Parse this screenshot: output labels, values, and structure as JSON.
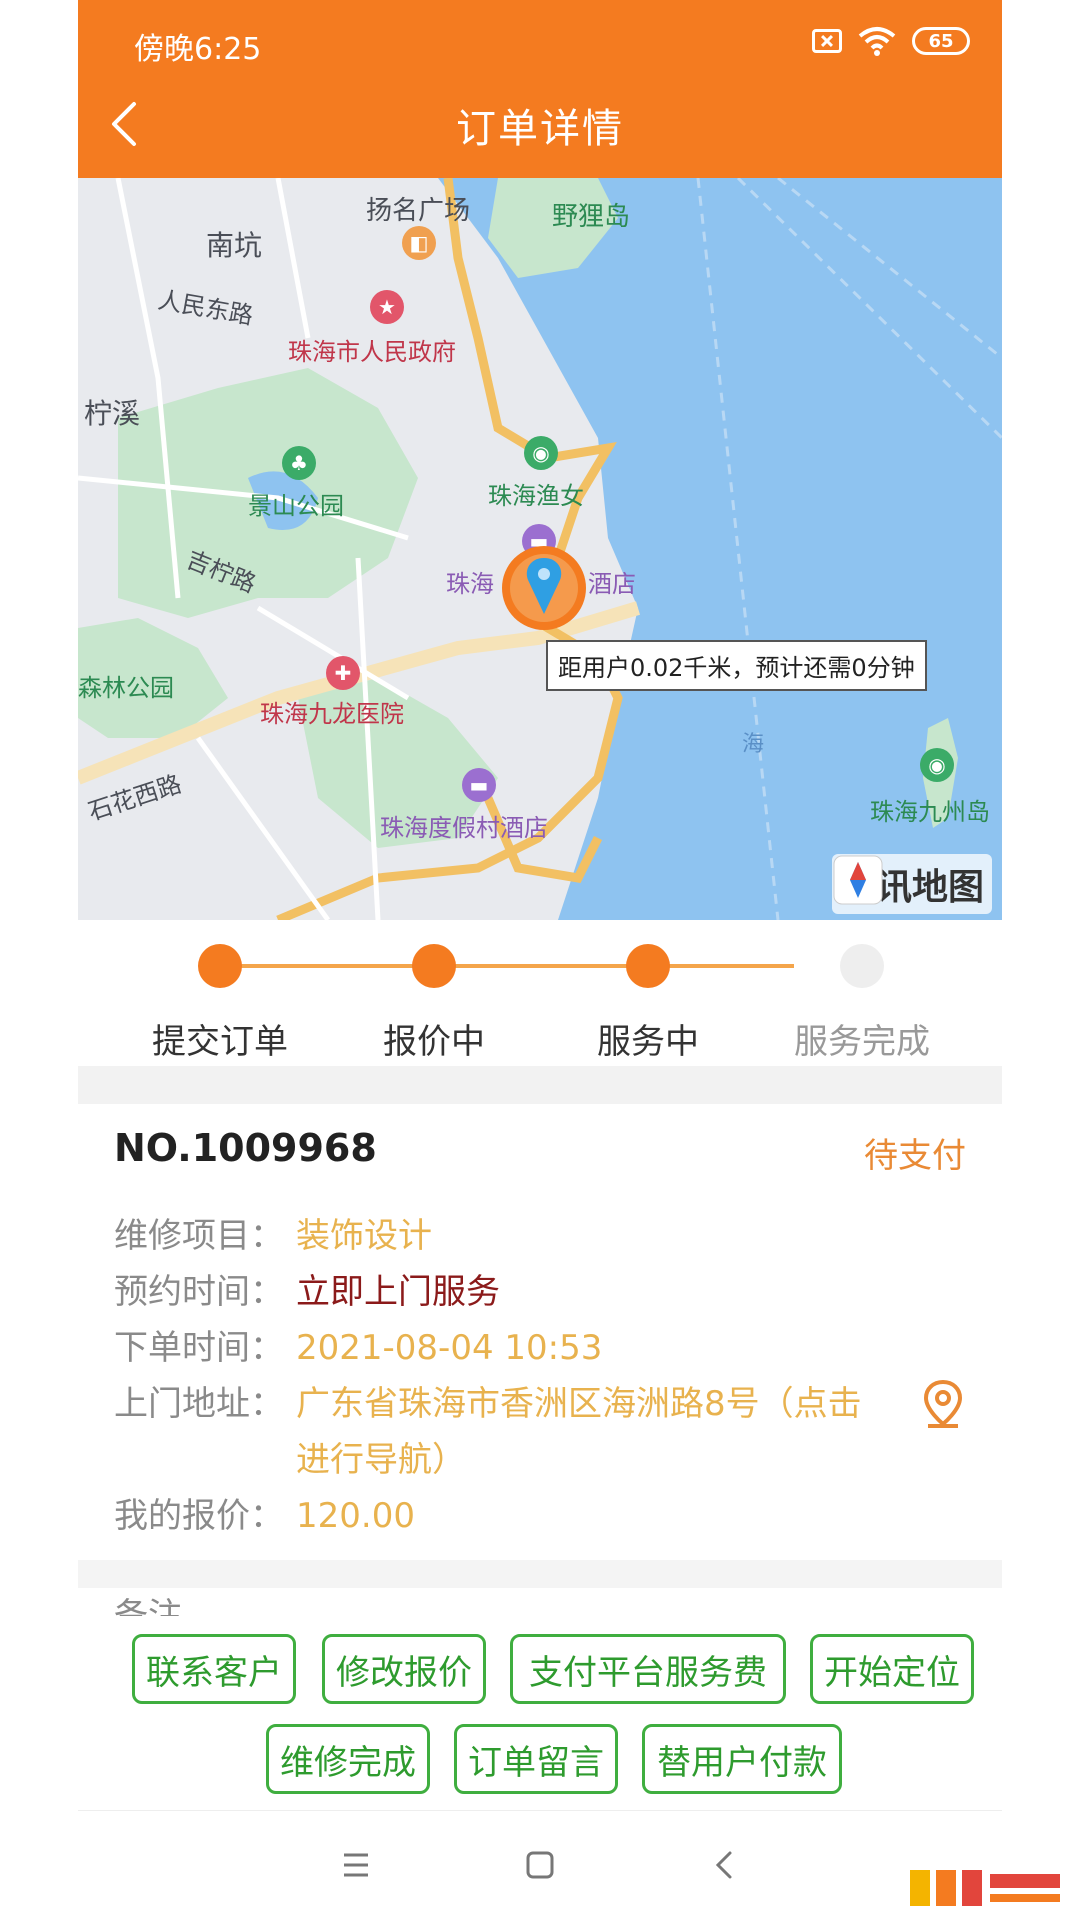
{
  "status_bar": {
    "time": "傍晚6:25",
    "battery": "65"
  },
  "header": {
    "title": "订单详情"
  },
  "map": {
    "labels": {
      "yangming": "扬名广场",
      "yeli": "野狸岛",
      "nankeng": "南坑",
      "renmin_road": "人民东路",
      "gov": "珠海市人民政府",
      "ningxi": "柠溪",
      "yunv": "珠海渔女",
      "jingshan": "景山公园",
      "jining_road": "吉柠路",
      "hotel_a": "珠海",
      "hotel_b": "酒店",
      "forest": "森林公园",
      "hospital": "珠海九龙医院",
      "shihua_road": "石花西路",
      "resort": "珠海度假村酒店",
      "jiuzhou": "珠海九州岛",
      "sea": "海"
    },
    "callout": "距用户0.02千米，预计还需0分钟",
    "logo": "腾讯地图"
  },
  "progress": {
    "steps": [
      {
        "label": "提交订单",
        "done": true
      },
      {
        "label": "报价中",
        "done": true
      },
      {
        "label": "服务中",
        "done": true
      },
      {
        "label": "服务完成",
        "done": false
      }
    ]
  },
  "order": {
    "number": "NO.1009968",
    "status": "待支付",
    "fields": {
      "project_label": "维修项目：",
      "project_value": "装饰设计",
      "appointment_label": "预约时间：",
      "appointment_value": "立即上门服务",
      "order_time_label": "下单时间：",
      "order_time_value": "2021-08-04 10:53",
      "address_label": "上门地址：",
      "address_value": "广东省珠海市香洲区海洲路8号（点击进行导航）",
      "quote_label": "我的报价：",
      "quote_value": "120.00"
    },
    "note_label": "备注"
  },
  "actions": {
    "contact": "联系客户",
    "modify_quote": "修改报价",
    "pay_fee": "支付平台服务费",
    "start_locate": "开始定位",
    "repair_done": "维修完成",
    "order_message": "订单留言",
    "pay_for_user": "替用户付款"
  },
  "colors": {
    "brand": "#f47b20",
    "button_green": "#3fae3f",
    "value_gold": "#e8b24e"
  },
  "icons": {
    "back": "chevron-left-icon",
    "location": "location-pin-icon",
    "nav_menu": "menu-icon",
    "nav_home": "square-icon",
    "nav_back": "chevron-left-icon"
  }
}
